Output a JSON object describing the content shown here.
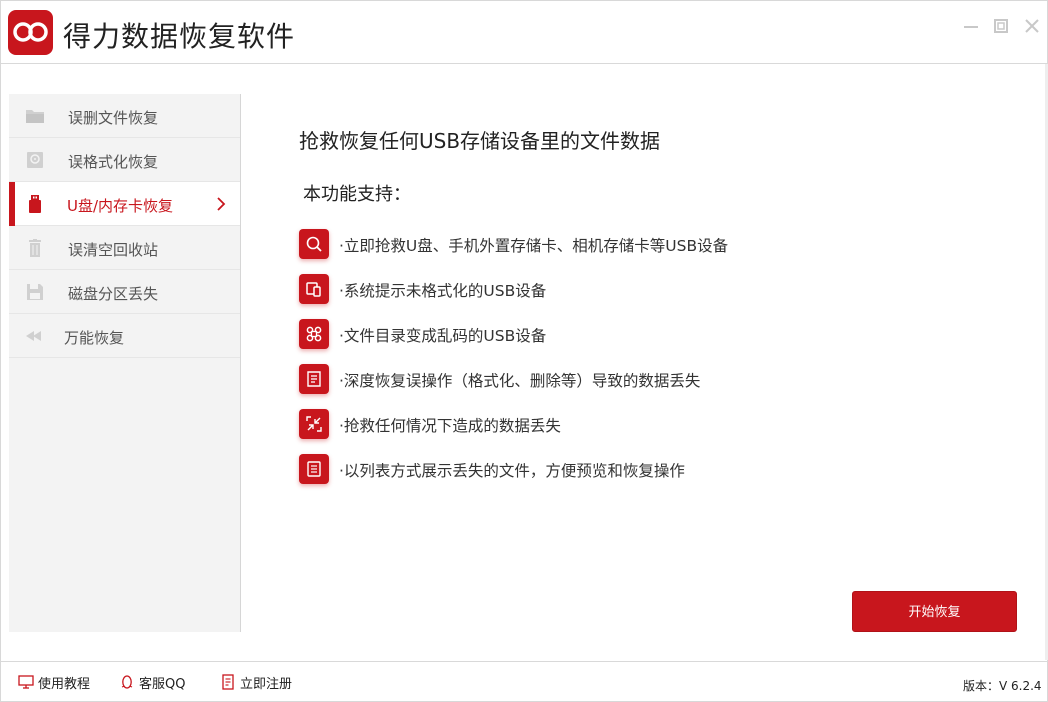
{
  "app": {
    "title": "得力数据恢复软件"
  },
  "colors": {
    "accent": "#c8161d",
    "sidebar_bg": "#f3f3f3"
  },
  "window_controls": {
    "minimize_icon": "minimize-icon",
    "maximize_icon": "maximize-icon",
    "close_icon": "close-icon"
  },
  "sidebar": {
    "items": [
      {
        "label": "误删文件恢复",
        "icon": "folder-icon",
        "active": false
      },
      {
        "label": "误格式化恢复",
        "icon": "disk-icon",
        "active": false
      },
      {
        "label": "U盘/内存卡恢复",
        "icon": "usb-drive-icon",
        "active": true
      },
      {
        "label": "误清空回收站",
        "icon": "trash-icon",
        "active": false
      },
      {
        "label": "磁盘分区丢失",
        "icon": "floppy-icon",
        "active": false
      },
      {
        "label": "万能恢复",
        "icon": "rewind-icon",
        "active": false
      }
    ]
  },
  "main": {
    "heading": "抢救恢复任何USB存储设备里的文件数据",
    "subheading": "本功能支持：",
    "features": [
      {
        "text": "·立即抢救U盘、手机外置存储卡、相机存储卡等USB设备",
        "icon": "search-icon"
      },
      {
        "text": "·系统提示未格式化的USB设备",
        "icon": "devices-icon"
      },
      {
        "text": "·文件目录变成乱码的USB设备",
        "icon": "command-icon"
      },
      {
        "text": "·深度恢复误操作（格式化、删除等）导致的数据丢失",
        "icon": "document-list-icon"
      },
      {
        "text": "·抢救任何情况下造成的数据丢失",
        "icon": "shrink-arrows-icon"
      },
      {
        "text": "·以列表方式展示丢失的文件，方便预览和恢复操作",
        "icon": "file-text-icon"
      }
    ],
    "start_button": "开始恢复"
  },
  "footer": {
    "tutorial": "使用教程",
    "qq": "客服QQ",
    "register": "立即注册",
    "version": "版本：V 6.2.4"
  }
}
